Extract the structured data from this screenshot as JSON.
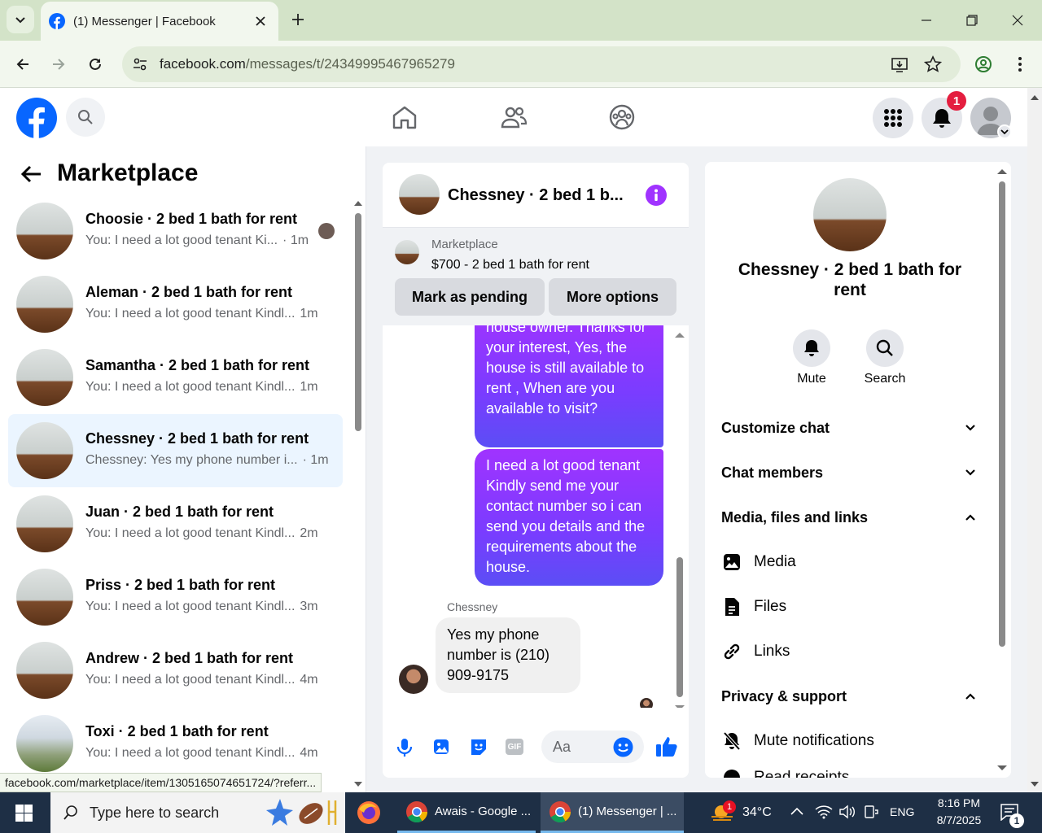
{
  "browser": {
    "tab_title": "(1) Messenger | Facebook",
    "url_host": "facebook.com",
    "url_path": "/messages/t/24349995467965279",
    "status_link": "facebook.com/marketplace/item/1305165074651724/?referr..."
  },
  "header": {
    "notification_count": "1"
  },
  "left_panel": {
    "title": "Marketplace",
    "conversations": [
      {
        "name": "Choosie · 2 bed 1 bath for rent",
        "preview": "You: I need a lot good tenant Ki...",
        "time": "· 1m",
        "active": false
      },
      {
        "name": "Aleman · 2 bed 1 bath for rent",
        "preview": "You: I need a lot good tenant Kindl...",
        "time": "1m",
        "active": false
      },
      {
        "name": "Samantha · 2 bed 1 bath for rent",
        "preview": "You: I need a lot good tenant Kindl...",
        "time": "1m",
        "active": false
      },
      {
        "name": "Chessney · 2 bed 1 bath for rent",
        "preview": "Chessney: Yes my phone number i...",
        "time": "· 1m",
        "active": true
      },
      {
        "name": "Juan · 2 bed 1 bath for rent",
        "preview": "You: I need a lot good tenant Kindl...",
        "time": "2m",
        "active": false
      },
      {
        "name": "Priss · 2 bed 1 bath for rent",
        "preview": "You: I need a lot good tenant Kindl...",
        "time": "3m",
        "active": false
      },
      {
        "name": "Andrew · 2 bed 1 bath for rent",
        "preview": "You: I need a lot good tenant Kindl...",
        "time": "4m",
        "active": false
      },
      {
        "name": "Toxi · 2 bed 1 bath for rent",
        "preview": "You: I need a lot good tenant Kindl...",
        "time": "4m",
        "active": false
      }
    ]
  },
  "chat": {
    "title": "Chessney · 2 bed 1 b...",
    "marketplace_label": "Marketplace",
    "listing": "$700 - 2 bed 1 bath for rent",
    "mark_pending": "Mark as pending",
    "more_options": "More options",
    "msg1": "house owner. Thanks for your interest, Yes, the house is still available to rent , When are you available to visit?",
    "msg2": "I need a lot good tenant Kindly send me your contact number so i can send you details and the requirements about the house.",
    "sender": "Chessney",
    "reply": "Yes my phone number is (210) 909-9175",
    "input_placeholder": "Aa",
    "gif_label": "GIF"
  },
  "info_panel": {
    "title": "Chessney · 2 bed 1 bath for rent",
    "mute": "Mute",
    "search": "Search",
    "customize_chat": "Customize chat",
    "chat_members": "Chat members",
    "media_files_links": "Media, files and links",
    "media": "Media",
    "files": "Files",
    "links": "Links",
    "privacy_support": "Privacy & support",
    "mute_notifications": "Mute notifications",
    "read_receipts": "Read receipts"
  },
  "taskbar": {
    "search_placeholder": "Type here to search",
    "app1": "Awais - Google ...",
    "app2": "(1) Messenger | ...",
    "weather_badge": "1",
    "temperature": "34°C",
    "language": "ENG",
    "time": "8:16 PM",
    "date": "8/7/2025",
    "notif_count": "1"
  },
  "colors": {
    "fb_blue": "#0866ff",
    "messenger_purple": "#8a2be2",
    "active_conv": "#ebf5ff",
    "chrome_green": "#d3e3c8"
  }
}
